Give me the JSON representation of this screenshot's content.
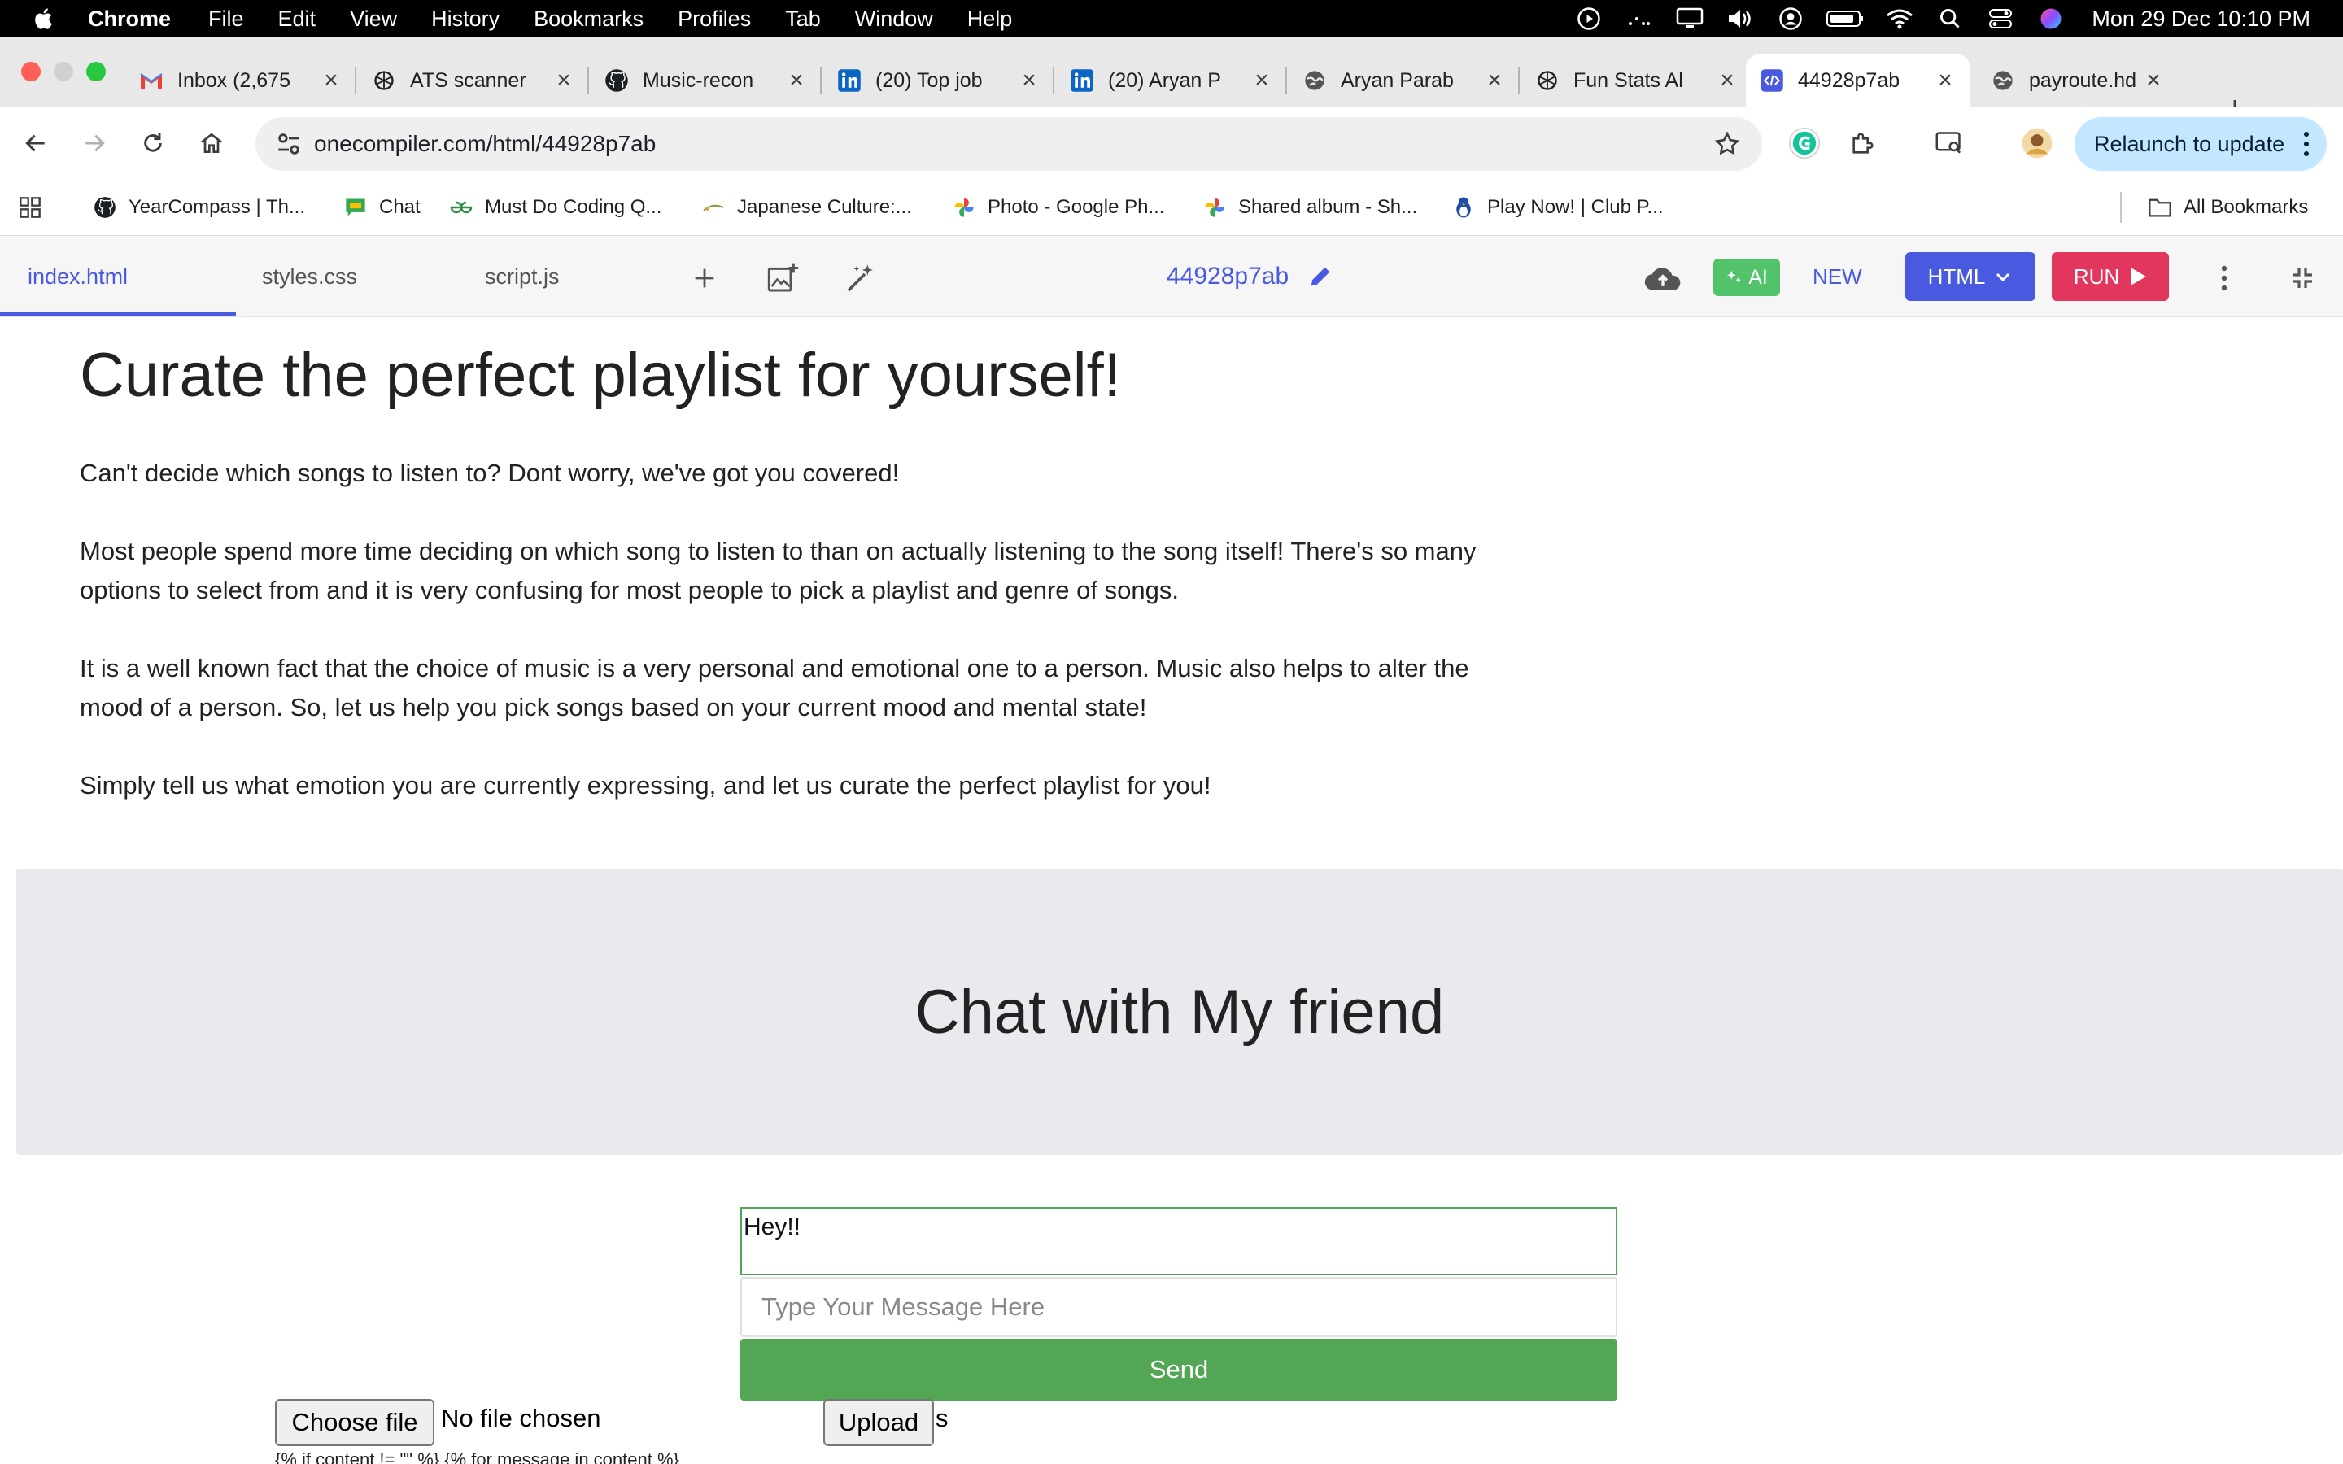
{
  "menubar": {
    "app_name": "Chrome",
    "items": [
      "File",
      "Edit",
      "View",
      "History",
      "Bookmarks",
      "Profiles",
      "Tab",
      "Window",
      "Help"
    ],
    "clock": "Mon 29 Dec  10:10 PM"
  },
  "tabs": [
    {
      "title": "Inbox (2,675",
      "icon": "gmail-icon"
    },
    {
      "title": "ATS scanner",
      "icon": "openai-icon"
    },
    {
      "title": "Music-recon",
      "icon": "github-icon"
    },
    {
      "title": "(20) Top job",
      "icon": "linkedin-icon"
    },
    {
      "title": "(20) Aryan P",
      "icon": "linkedin-icon"
    },
    {
      "title": "Aryan Parab",
      "icon": "globe-icon"
    },
    {
      "title": "Fun Stats Al",
      "icon": "openai-icon"
    },
    {
      "title": "44928p7ab",
      "icon": "code-icon",
      "active": true
    },
    {
      "title": "payroute.hd",
      "icon": "globe-icon"
    }
  ],
  "toolbar": {
    "url": "onecompiler.com/html/44928p7ab",
    "relaunch_label": "Relaunch to update"
  },
  "bookmarks": [
    {
      "label": "YearCompass | Th...",
      "icon": "github-icon"
    },
    {
      "label": "Chat",
      "icon": "chat-icon"
    },
    {
      "label": "Must Do Coding Q...",
      "icon": "gfg-icon"
    },
    {
      "label": "Japanese Culture:...",
      "icon": "leaf-icon"
    },
    {
      "label": "Photo - Google Ph...",
      "icon": "google-photos-icon"
    },
    {
      "label": "Shared album - Sh...",
      "icon": "google-photos-icon"
    },
    {
      "label": "Play Now! | Club P...",
      "icon": "penguin-icon"
    }
  ],
  "all_bookmarks_label": "All Bookmarks",
  "editor": {
    "files": [
      "index.html",
      "styles.css",
      "script.js"
    ],
    "doc_name": "44928p7ab",
    "ai_label": "AI",
    "new_label": "NEW",
    "lang_label": "HTML",
    "run_label": "RUN"
  },
  "page": {
    "heading": "Curate the perfect playlist for yourself!",
    "paragraphs": [
      "Can't decide which songs to listen to? Dont worry, we've got you covered!",
      "Most people spend more time deciding on which song to listen to than on actually listening to the song itself! There's so many options to select from and it is very confusing for most people to pick a playlist and genre of songs.",
      "It is a well known fact that the choice of music is a very personal and emotional one to a person. Music also helps to alter the mood of a person. So, let us help you pick songs based on your current mood and mental state!",
      "Simply tell us what emotion you are currently expressing, and let us curate the perfect playlist for you!"
    ],
    "chat_title": "Chat with My friend",
    "chat_log": "Hey!!",
    "message_placeholder": "Type Your Message Here",
    "send_label": "Send",
    "choose_file_label": "Choose file",
    "no_file_label": "No file chosen",
    "upload_label": "Upload",
    "upload_suffix": "s",
    "template_code": "{% if content != \"\" %} {% for message in content %}"
  },
  "colors": {
    "editor_accent": "#4a5ae0",
    "ai_green": "#52c36b",
    "run_red": "#e3365f",
    "send_green": "#53a653",
    "relaunch_blue": "#c3e7ff"
  }
}
